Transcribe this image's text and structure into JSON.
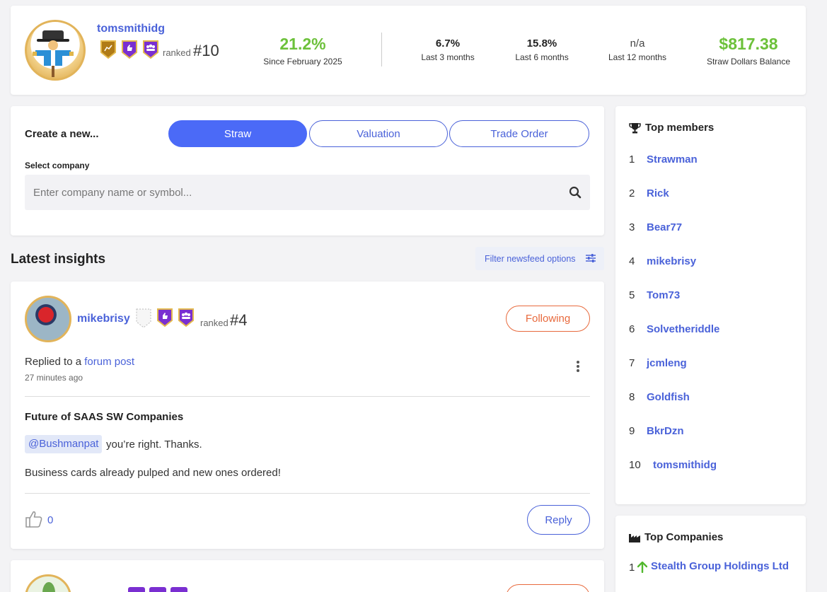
{
  "profile": {
    "username": "tomsmithidg",
    "ranked_label": "ranked",
    "rank": "#10",
    "main_return": "21.2%",
    "main_return_label": "Since February 2025",
    "stats": [
      {
        "value": "6.7%",
        "label": "Last 3 months"
      },
      {
        "value": "15.8%",
        "label": "Last 6 months"
      },
      {
        "value": "n/a",
        "label": "Last 12 months"
      }
    ],
    "balance": "$817.38",
    "balance_label": "Straw Dollars Balance"
  },
  "create": {
    "label": "Create a new...",
    "tabs": [
      "Straw",
      "Valuation",
      "Trade Order"
    ],
    "active_tab": "Straw",
    "select_label": "Select company",
    "search_placeholder": "Enter company name or symbol..."
  },
  "feed": {
    "title": "Latest insights",
    "filter_label": "Filter newsfeed options"
  },
  "post": {
    "username": "mikebrisy",
    "ranked_label": "ranked",
    "rank": "#4",
    "follow_label": "Following",
    "activity_prefix": "Replied to a",
    "activity_link": "forum post",
    "time_ago": "27 minutes ago",
    "title": "Future of SAAS SW Companies",
    "mention": "@Bushmanpat",
    "line1": "you’re right. Thanks.",
    "line2": "Business cards already pulped and new ones ordered!",
    "likes": "0",
    "reply_label": "Reply"
  },
  "top_members": {
    "title": "Top members",
    "items": [
      {
        "rank": "1",
        "name": "Strawman"
      },
      {
        "rank": "2",
        "name": "Rick"
      },
      {
        "rank": "3",
        "name": "Bear77"
      },
      {
        "rank": "4",
        "name": "mikebrisy"
      },
      {
        "rank": "5",
        "name": "Tom73"
      },
      {
        "rank": "6",
        "name": "Solvetheriddle"
      },
      {
        "rank": "7",
        "name": "jcmleng"
      },
      {
        "rank": "8",
        "name": "Goldfish"
      },
      {
        "rank": "9",
        "name": "BkrDzn"
      },
      {
        "rank": "10",
        "name": "tomsmithidg"
      }
    ]
  },
  "top_companies": {
    "title": "Top Companies",
    "items": [
      {
        "rank": "1",
        "name": "Stealth Group Holdings Ltd",
        "trend": "up"
      }
    ]
  },
  "colors": {
    "accent": "#4a62d9",
    "active_tab": "#4b6af7",
    "positive": "#6cc13a",
    "follow": "#e86a3d",
    "badge_purple": "#7a2fd1",
    "badge_gold": "#c98d1e"
  },
  "icons": [
    "scarecrow-avatar",
    "chart-badge-icon",
    "thumbs-up-badge-icon",
    "group-badge-icon",
    "search-icon",
    "sliders-icon",
    "kebab-icon",
    "like-icon",
    "trophy-icon",
    "factory-icon",
    "arrow-up-icon"
  ]
}
